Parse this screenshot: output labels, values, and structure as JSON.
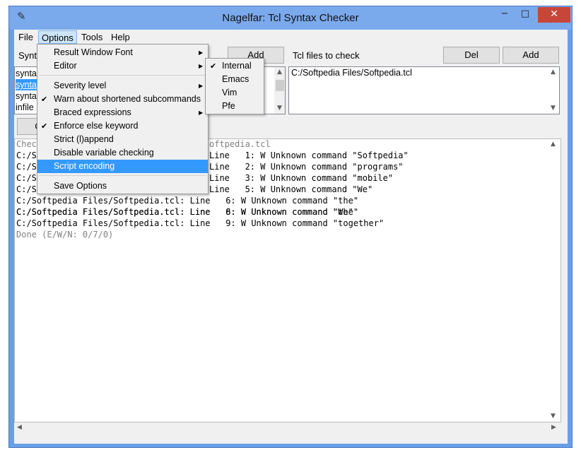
{
  "window": {
    "title": "Nagelfar: Tcl Syntax Checker",
    "minimize": "−",
    "maximize": "□",
    "close": "✕"
  },
  "menubar": [
    "File",
    "Options",
    "Tools",
    "Help"
  ],
  "left_panel": {
    "label_partial": "Synta",
    "add_label": "Add",
    "list_items": [
      "synta",
      "synta",
      "synta",
      "infile"
    ],
    "check_partial": "C"
  },
  "right_panel": {
    "label": "Tcl files to check",
    "del_label": "Del",
    "add_label": "Add",
    "files": [
      "C:/Softpedia Files/Softpedia.tcl"
    ]
  },
  "output": {
    "lines": [
      "Checking file C:/Softpedia Files/Softpedia.tcl",
      "C:/Softpedia Files/Softpedia.tcl: Line   1: W Unknown command \"Softpedia\"",
      "C:/Softpedia Files/Softpedia.tcl: Line   2: W Unknown command \"programs\"",
      "C:/Softpedia Files/Softpedia.tcl: Line   3: W Unknown command \"mobile\"",
      "C:/Softpedia Files/Softpedia.tcl: Line   5: W Unknown command \"We\"",
      "C:/Softpedia Files/Softpedia.tcl: Line   6: W Unknown command \"the\"",
      "C:/Softpedia Files/Softpedia.tcl: Line   8: W Unknown command \"We\"",
      "C:/Softpedia Files/Softpedia.tcl: Line   9: W Unknown command \"together\"",
      "Done (E/W/N: 0/7/0)"
    ],
    "visible_fragments": [
      "Chec",
      "oftpedia.tcl",
      "C:/S",
      "C:/S",
      "C:/S",
      "C:/S"
    ],
    "line_tails": [
      "Line   1: W Unknown command \"Softpedia\"",
      "Line   2: W Unknown command \"programs\"",
      "Line   3: W Unknown command \"mobile\"",
      "Line   5: W Unknown command \"We\""
    ]
  },
  "options_menu": {
    "items": [
      {
        "label": "Result Window Font",
        "submenu": true
      },
      {
        "label": "Editor",
        "submenu": true
      },
      {
        "label": "Severity level",
        "submenu": true
      },
      {
        "label": "Warn about shortened subcommands",
        "checked": true
      },
      {
        "label": "Braced expressions",
        "submenu": true
      },
      {
        "label": "Enforce else keyword",
        "checked": true
      },
      {
        "label": "Strict (l)append"
      },
      {
        "label": "Disable variable checking"
      },
      {
        "label": "Script encoding",
        "highlighted": true
      },
      {
        "label": "Save Options"
      }
    ]
  },
  "editor_submenu": {
    "items": [
      {
        "label": "Internal",
        "checked": true
      },
      {
        "label": "Emacs"
      },
      {
        "label": "Vim"
      },
      {
        "label": "Pfe"
      }
    ]
  },
  "icons": {
    "app": "feather-icon",
    "check": "checkmark-icon",
    "submenu": "triangle-right-icon"
  },
  "colors": {
    "highlight": "#3399ff",
    "titlebar": "#7aa9ec",
    "close": "#c7463a"
  }
}
